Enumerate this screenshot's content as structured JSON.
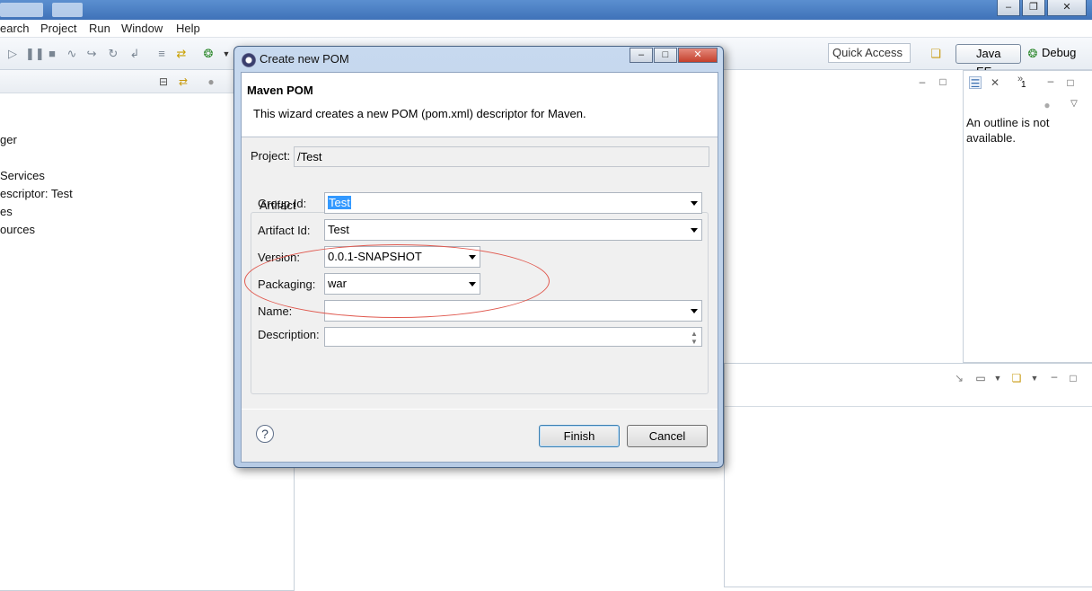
{
  "menu": [
    "earch",
    "Project",
    "Run",
    "Window",
    "Help"
  ],
  "toolbar": {
    "quick_access": "Quick Access",
    "perspective_java_ee": "Java EE",
    "perspective_debug": "Debug"
  },
  "tree": [
    "ger",
    "Services",
    "escriptor: Test",
    "es",
    "ources"
  ],
  "outline": {
    "message": "An outline is not available."
  },
  "tray_count": "1",
  "dialog": {
    "title": "Create new POM",
    "heading": "Maven POM",
    "description": "This wizard creates a new POM (pom.xml) descriptor for Maven.",
    "project_label": "Project:",
    "project_value": "/Test",
    "group_title": "Artifact",
    "group_id_label": "Group Id:",
    "group_id_value": "Test",
    "artifact_id_label": "Artifact Id:",
    "artifact_id_value": "Test",
    "version_label": "Version:",
    "version_value": "0.0.1-SNAPSHOT",
    "packaging_label": "Packaging:",
    "packaging_value": "war",
    "name_label": "Name:",
    "name_value": "",
    "description_label": "Description:",
    "description_value": "",
    "finish": "Finish",
    "cancel": "Cancel",
    "help_glyph": "?"
  }
}
